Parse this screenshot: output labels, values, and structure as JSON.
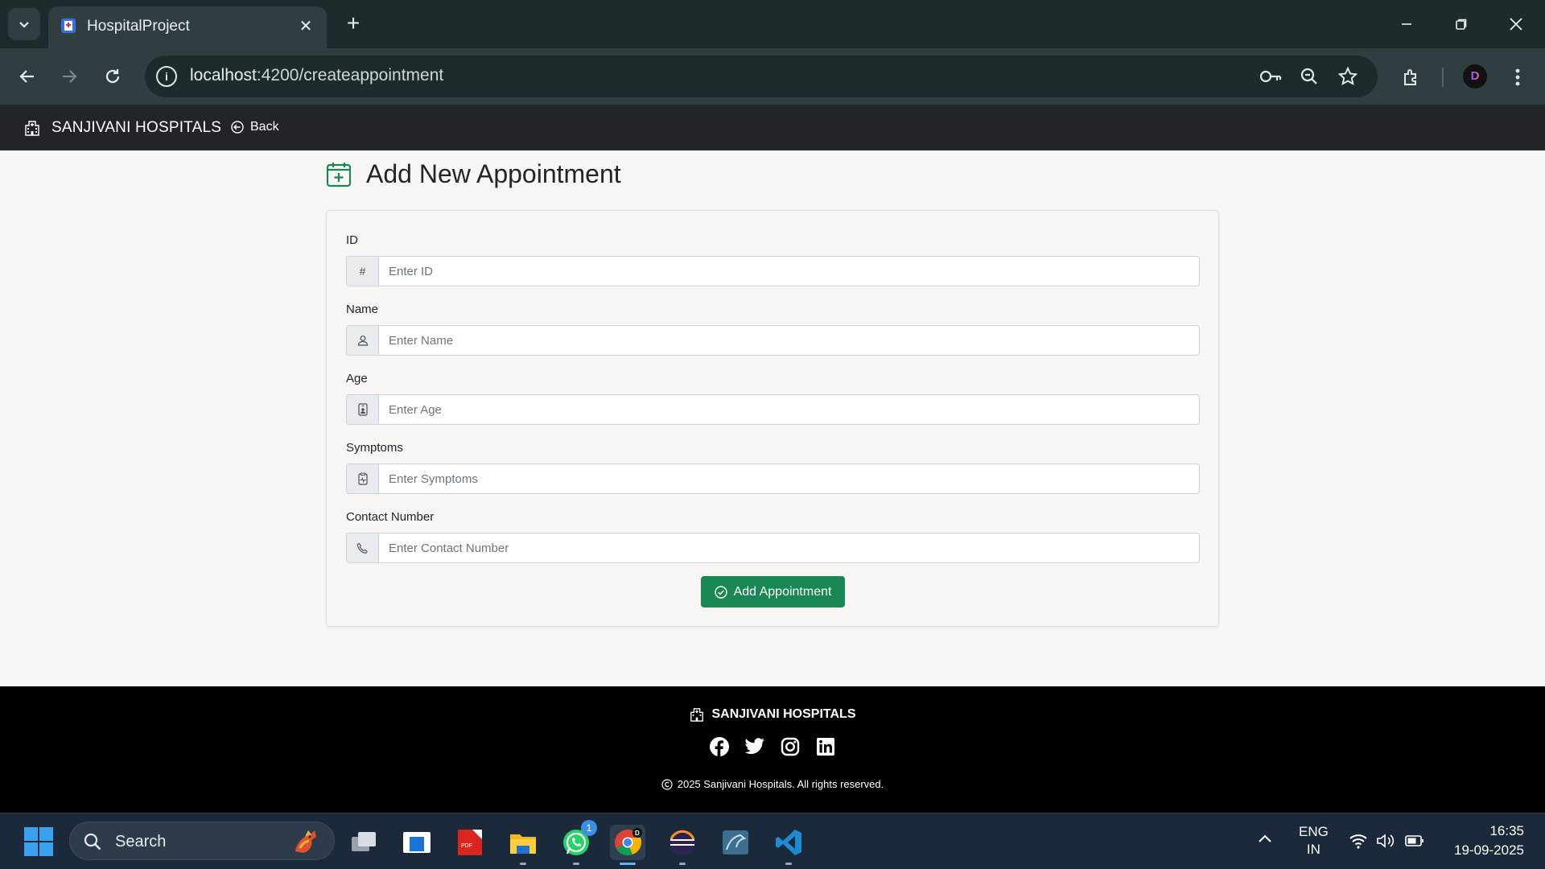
{
  "browser": {
    "tab_title": "HospitalProject",
    "url_host": "localhost",
    "url_path": ":4200/createappointment"
  },
  "navbar": {
    "brand": "SANJIVANI HOSPITALS",
    "back_label": "Back"
  },
  "page": {
    "title": "Add New Appointment"
  },
  "form": {
    "fields": [
      {
        "label": "ID",
        "placeholder": "Enter ID",
        "addon": "#",
        "icon": "hash-icon"
      },
      {
        "label": "Name",
        "placeholder": "Enter Name",
        "icon": "person-icon"
      },
      {
        "label": "Age",
        "placeholder": "Enter Age",
        "icon": "person-badge-icon"
      },
      {
        "label": "Symptoms",
        "placeholder": "Enter Symptoms",
        "icon": "clipboard-pulse-icon"
      },
      {
        "label": "Contact Number",
        "placeholder": "Enter Contact Number",
        "icon": "telephone-icon"
      }
    ],
    "submit_label": "Add Appointment"
  },
  "footer": {
    "brand": "SANJIVANI HOSPITALS",
    "copyright": "2025 Sanjivani Hospitals. All rights reserved.",
    "socials": [
      "facebook-icon",
      "twitter-icon",
      "instagram-icon",
      "linkedin-icon"
    ]
  },
  "taskbar": {
    "search_label": "Search",
    "whatsapp_badge": "1",
    "lang_line1": "ENG",
    "lang_line2": "IN",
    "time": "16:35",
    "date": "19-09-2025"
  },
  "colors": {
    "success": "#198754",
    "navbar": "#212529",
    "footer": "#000000"
  }
}
